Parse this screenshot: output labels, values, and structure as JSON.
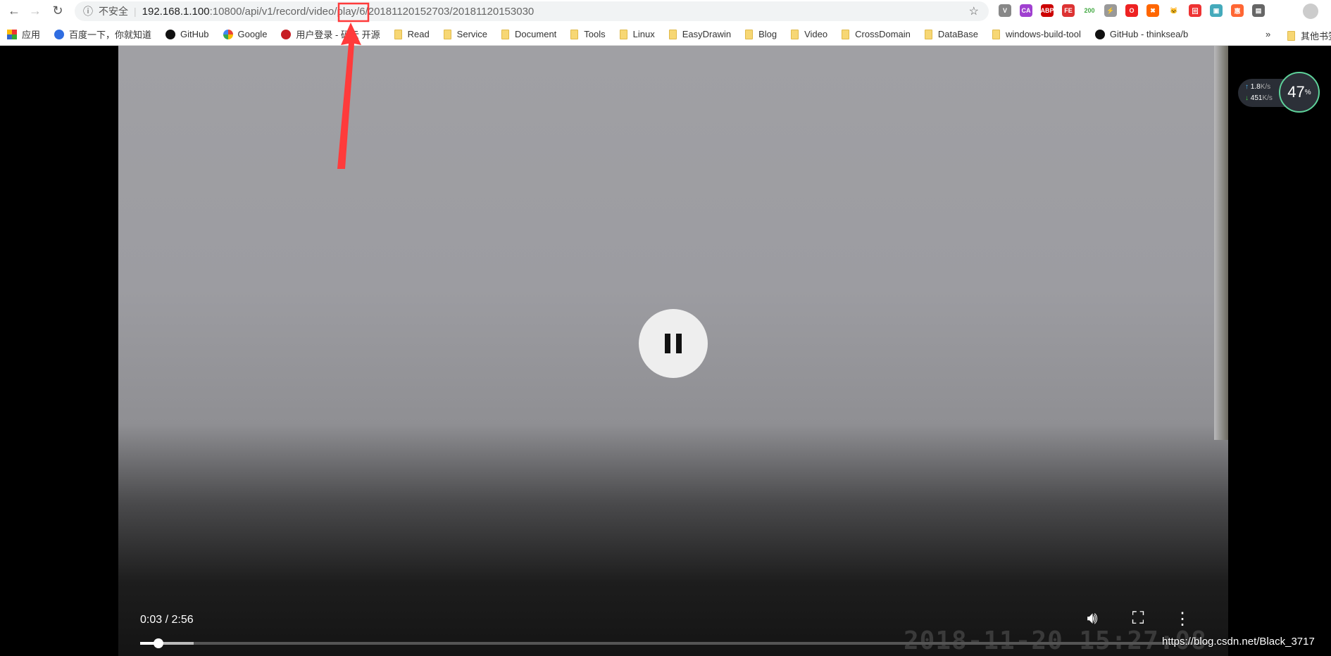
{
  "browser": {
    "security_label": "不安全",
    "url_host": "192.168.1.100",
    "url_path": ":10800/api/v1/record/video/play/6/20181120152703/20181120153030",
    "extensions": [
      {
        "label": "V",
        "color": "#888"
      },
      {
        "label": "CA",
        "color": "#a040d0"
      },
      {
        "label": "ABP",
        "color": "#c00"
      },
      {
        "label": "FE",
        "color": "#d33"
      },
      {
        "label": "200",
        "color": "#fff"
      },
      {
        "label": "⚡",
        "color": "#999"
      },
      {
        "label": "O",
        "color": "#e22"
      },
      {
        "label": "✖",
        "color": "#f60"
      },
      {
        "label": "🐱",
        "color": "#fff"
      },
      {
        "label": "回",
        "color": "#e33"
      },
      {
        "label": "▣",
        "color": "#4ab"
      },
      {
        "label": "惠",
        "color": "#f63"
      },
      {
        "label": "▤",
        "color": "#666"
      }
    ],
    "bookmarks": [
      {
        "label": "应用",
        "type": "apps"
      },
      {
        "label": "百度一下，你就知道",
        "type": "baidu"
      },
      {
        "label": "GitHub",
        "type": "github"
      },
      {
        "label": "Google",
        "type": "google"
      },
      {
        "label": "用户登录 - 码云 开源",
        "type": "gitee"
      },
      {
        "label": "Read",
        "type": "folder"
      },
      {
        "label": "Service",
        "type": "folder"
      },
      {
        "label": "Document",
        "type": "folder"
      },
      {
        "label": "Tools",
        "type": "folder"
      },
      {
        "label": "Linux",
        "type": "folder"
      },
      {
        "label": "EasyDrawin",
        "type": "folder"
      },
      {
        "label": "Blog",
        "type": "folder"
      },
      {
        "label": "Video",
        "type": "folder"
      },
      {
        "label": "CrossDomain",
        "type": "folder"
      },
      {
        "label": "DataBase",
        "type": "folder"
      },
      {
        "label": "windows-build-tool",
        "type": "folder"
      },
      {
        "label": "GitHub - thinksea/b",
        "type": "github"
      }
    ],
    "overflow_label": "»",
    "other_bookmarks": "其他书签"
  },
  "player": {
    "time": "0:03 / 2:56",
    "progress_fraction": 0.017,
    "buffered_fraction": 0.05,
    "timestamp_overlay": "2018-11-20 15:27:08",
    "state": "playing"
  },
  "netmonitor": {
    "up": "1.8",
    "down": "451",
    "unit": "K/s",
    "percent": "47",
    "percent_sign": "%"
  },
  "watermark": "https://blog.csdn.net/Black_3717",
  "annotation_color": "#ff3b3b"
}
